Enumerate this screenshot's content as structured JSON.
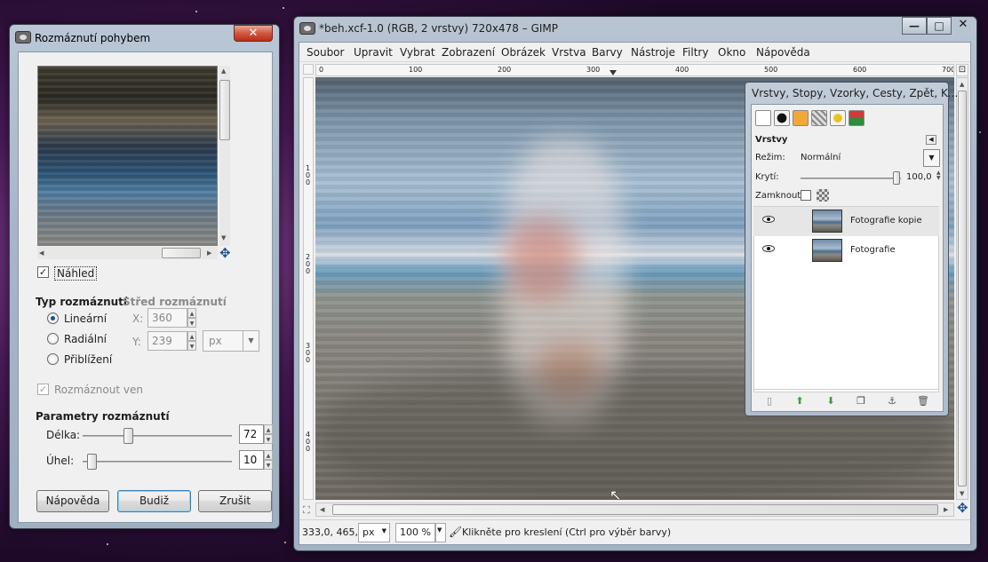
{
  "dialog": {
    "title": "Rozmáznutí pohybem",
    "close_label": "✕",
    "preview_label": "Náhled",
    "blur_type_heading": "Typ rozmáznutí",
    "center_heading": "Střed rozmáznutí",
    "types": [
      "Lineární",
      "Radiální",
      "Přiblížení"
    ],
    "selected_type": "Lineární",
    "x_label": "X:",
    "x_value": "360",
    "y_label": "Y:",
    "y_value": "239",
    "unit": "px",
    "blur_outward_label": "Rozmáznout ven",
    "params_heading": "Parametry rozmáznutí",
    "length_label": "Délka:",
    "length_value": "72",
    "length_fraction": 0.29,
    "angle_label": "Úhel:",
    "angle_value": "10",
    "angle_fraction": 0.03,
    "buttons": {
      "help": "Nápověda",
      "ok": "Budiž",
      "cancel": "Zrušit"
    }
  },
  "window": {
    "title": "*beh.xcf-1.0 (RGB, 2 vrstvy) 720x478 – GIMP",
    "menu": [
      "Soubor",
      "Upravit",
      "Vybrat",
      "Zobrazení",
      "Obrázek",
      "Vrstva",
      "Barvy",
      "Nástroje",
      "Filtry",
      "Okno",
      "Nápověda"
    ],
    "ruler_h": [
      "0",
      "100",
      "200",
      "300",
      "400",
      "500",
      "600",
      "700"
    ],
    "ruler_v": [
      "1\n0\n0",
      "2\n0\n0",
      "3\n0\n0",
      "4\n0\n0"
    ],
    "status": {
      "coords": "333,0, 465,0",
      "unit": "px",
      "zoom": "100 %",
      "message": "Klikněte pro kreslení (Ctrl pro výběr barvy)"
    }
  },
  "dock": {
    "title": "Vrstvy, Stopy, Vzorky, Cesty, Zpět, K...",
    "section": "Vrstvy",
    "mode_label": "Režim:",
    "mode_value": "Normální",
    "opacity_label": "Krytí:",
    "opacity_value": "100,0",
    "lock_label": "Zamknout:",
    "layers": [
      "Fotografie kopie",
      "Fotografie"
    ]
  }
}
